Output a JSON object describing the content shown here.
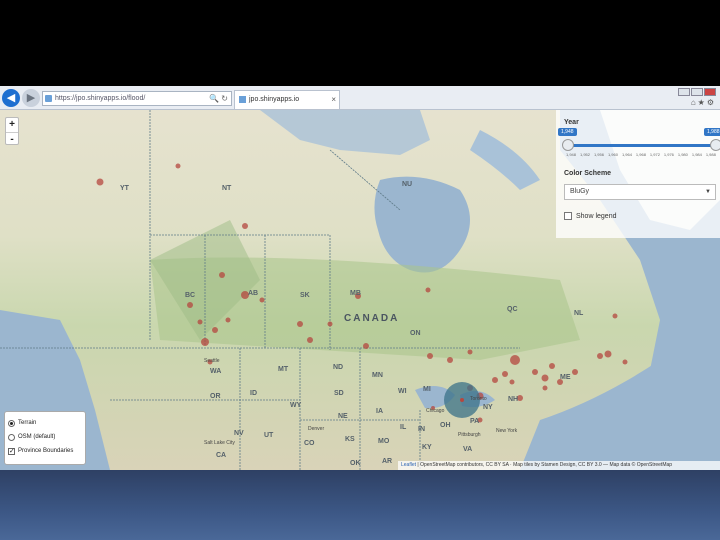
{
  "browser": {
    "url": "https://jpo.shinyapps.io/flood/",
    "tab_title": "jpo.shinyapps.io",
    "back_icon": "back-arrow-icon",
    "forward_icon": "forward-arrow-icon"
  },
  "map": {
    "zoom_in": "+",
    "zoom_out": "-",
    "country_label": "CANADA",
    "provinces": [
      "YT",
      "NT",
      "NU",
      "BC",
      "AB",
      "SK",
      "MB",
      "ON",
      "QC",
      "NL",
      "WA",
      "MT",
      "ND",
      "MN",
      "OR",
      "ID",
      "SD",
      "WY",
      "NE",
      "IA",
      "WI",
      "MI",
      "NY",
      "NH",
      "ME",
      "IL",
      "IN",
      "OH",
      "PA",
      "NV",
      "UT",
      "CO",
      "KS",
      "MO",
      "KY",
      "VA",
      "CA",
      "OK",
      "AR"
    ],
    "cities": [
      "Seattle",
      "Chicago",
      "Toronto",
      "Denver",
      "Salt Lake City",
      "Pittsburgh",
      "New York"
    ],
    "colors": {
      "water": "#9bb6cf",
      "marker": "#b5473f",
      "accent": "#3176c6"
    }
  },
  "controls": {
    "year_label": "Year",
    "year_min": "1,948",
    "year_max": "1,988",
    "ticks": [
      "1,948",
      "1,952",
      "1,956",
      "1,960",
      "1,964",
      "1,968",
      "1,972",
      "1,976",
      "1,980",
      "1,984",
      "1,988"
    ],
    "color_scheme_label": "Color Scheme",
    "color_scheme_value": "BluGy",
    "show_legend_label": "Show legend",
    "show_legend_checked": false
  },
  "layers": {
    "terrain_label": "Terrain",
    "osm_label": "OSM (default)",
    "boundaries_label": "Province Boundaries",
    "selected": "Terrain",
    "boundaries_checked": true
  },
  "attribution": {
    "leaflet": "Leaflet",
    "text": "| OpenStreetMap contributors, CC BY SA · Map tiles by Stamen Design, CC BY 3.0 — Map data © OpenStreetMap"
  }
}
